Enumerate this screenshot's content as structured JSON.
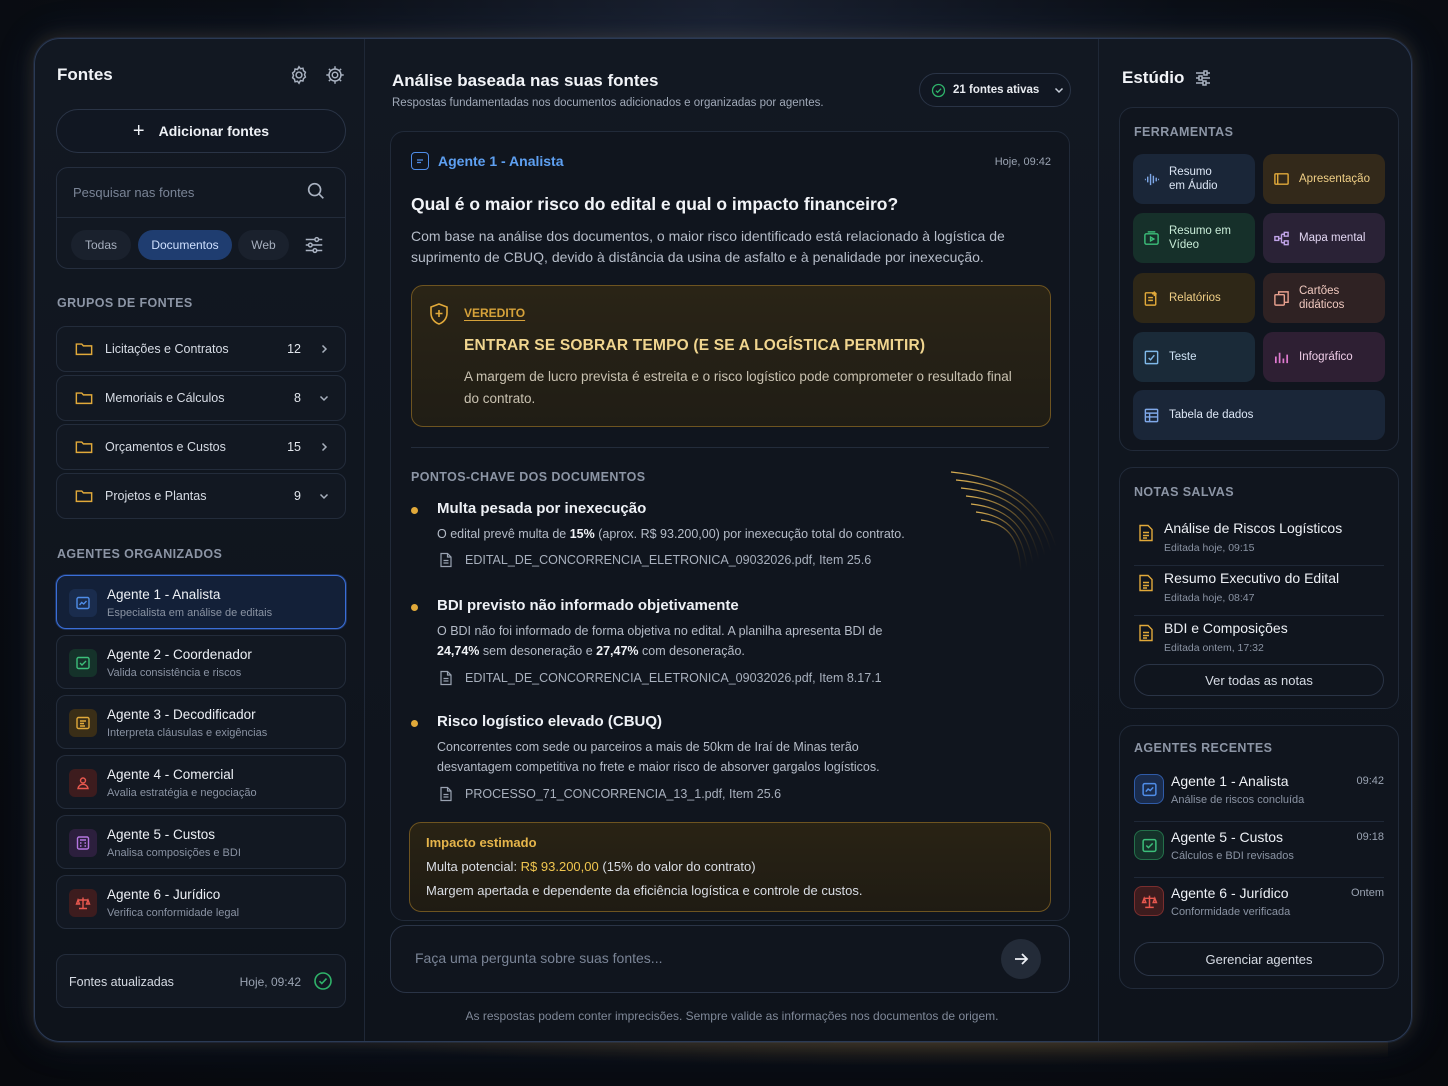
{
  "left": {
    "title": "Fontes",
    "add_sources": "Adicionar fontes",
    "search_placeholder": "Pesquisar nas fontes",
    "filters": [
      "Todas",
      "Documentos",
      "Web"
    ],
    "active_filter": "Documentos",
    "groups_label": "GRUPOS DE FONTES",
    "groups": [
      {
        "name": "Licitações e Contratos",
        "count": "12",
        "expanded": false
      },
      {
        "name": "Memoriais e Cálculos",
        "count": "8",
        "expanded": true
      },
      {
        "name": "Orçamentos e Custos",
        "count": "15",
        "expanded": false
      },
      {
        "name": "Projetos e Plantas",
        "count": "9",
        "expanded": true
      }
    ],
    "agents_label": "AGENTES ORGANIZADOS",
    "agents": [
      {
        "name": "Agente 1 - Analista",
        "desc": "Especialista em análise de editais",
        "color": "#4f8de8",
        "bg": "#1a2c4d",
        "icon": "chart-icon"
      },
      {
        "name": "Agente 2 - Coordenador",
        "desc": "Valida consistência e riscos",
        "color": "#3cbf7a",
        "bg": "#15322a",
        "icon": "check-square-icon"
      },
      {
        "name": "Agente 3 - Decodificador",
        "desc": "Interpreta cláusulas e exigências",
        "color": "#e1a93a",
        "bg": "#3a2e17",
        "icon": "document-scan-icon"
      },
      {
        "name": "Agente 4 - Comercial",
        "desc": "Avalia estratégia e negociação",
        "color": "#e8584f",
        "bg": "#3d1c1e",
        "icon": "person-icon"
      },
      {
        "name": "Agente 5 - Custos",
        "desc": "Analisa composições e BDI",
        "color": "#b476e0",
        "bg": "#2c1f3d",
        "icon": "calculator-icon"
      },
      {
        "name": "Agente 6 - Jurídico",
        "desc": "Verifica conformidade legal",
        "color": "#e8584f",
        "bg": "#3d1c1e",
        "icon": "scale-icon"
      }
    ],
    "active_agent": 0,
    "updated_label": "Fontes atualizadas",
    "updated_time": "Hoje, 09:42"
  },
  "main": {
    "title": "Análise baseada nas suas fontes",
    "subtitle": "Respostas fundamentadas nos documentos adicionados e organizadas por agentes.",
    "active_sources": "21 fontes ativas",
    "agent": "Agente 1 - Analista",
    "time": "Hoje, 09:42",
    "question": "Qual é o maior risco do edital e qual o impacto financeiro?",
    "answer": "Com base na análise dos documentos, o maior risco identificado está relacionado à logística de suprimento de CBUQ, devido à distância da usina de asfalto e à penalidade por inexecução.",
    "verdict": {
      "label": "VEREDITO",
      "headline": "ENTRAR SE SOBRAR TEMPO (E SE A LOGÍSTICA PERMITIR)",
      "text": "A margem de lucro prevista é estreita e o risco logístico pode comprometer o resultado final do contrato."
    },
    "key_points_label": "PONTOS-CHAVE DOS DOCUMENTOS",
    "key_points": [
      {
        "title": "Multa pesada por inexecução",
        "desc_html": "O edital prevê multa de <b>15%</b> (aprox. R$ 93.200,00) por inexecução total do contrato.",
        "source": "EDITAL_DE_CONCORRENCIA_ELETRONICA_09032026.pdf, Item 25.6"
      },
      {
        "title": "BDI previsto não informado objetivamente",
        "desc_html": "O BDI não foi informado de forma objetiva no edital. A planilha apresenta BDI de <b>24,74%</b> sem desoneração e <b>27,47%</b> com desoneração.",
        "source": "EDITAL_DE_CONCORRENCIA_ELETRONICA_09032026.pdf, Item 8.17.1"
      },
      {
        "title": "Risco logístico elevado (CBUQ)",
        "desc_html": "Concorrentes com sede ou parceiros a mais de 50km de Iraí de Minas terão desvantagem competitiva no frete e maior risco de absorver gargalos logísticos.",
        "source": "PROCESSO_71_CONCORRENCIA_13_1.pdf, Item 25.6"
      }
    ],
    "impact": {
      "label": "Impacto estimado",
      "line1_prefix": "Multa potencial: ",
      "line1_amount": "R$ 93.200,00",
      "line1_suffix": " (15% do valor do contrato)",
      "line2": "Margem apertada e dependente da eficiência logística e controle de custos."
    },
    "ask_placeholder": "Faça uma pergunta sobre suas fontes...",
    "disclaimer": "As respostas podem conter imprecisões. Sempre valide as informações nos documentos de origem."
  },
  "right": {
    "title": "Estúdio",
    "tools_label": "FERRAMENTAS",
    "tools": [
      {
        "label": "Resumo em Áudio",
        "color": "#7fa8e8",
        "bg": "#1a2638",
        "icon": "audio-wave-icon"
      },
      {
        "label": "Apresentação",
        "color": "#e1a93a",
        "bg": "#33291a",
        "icon": "presentation-icon"
      },
      {
        "label": "Resumo em Vídeo",
        "color": "#3cbf7a",
        "bg": "#16302a",
        "icon": "video-icon"
      },
      {
        "label": "Mapa mental",
        "color": "#c1a4e8",
        "bg": "#2a2236",
        "icon": "mind-map-icon"
      },
      {
        "label": "Relatórios",
        "color": "#e1a93a",
        "bg": "#2e2717",
        "icon": "report-icon"
      },
      {
        "label": "Cartões didáticos",
        "color": "#e8a08e",
        "bg": "#2f2223",
        "icon": "flashcards-icon"
      },
      {
        "label": "Teste",
        "color": "#7fb8e8",
        "bg": "#1a2a38",
        "icon": "quiz-icon"
      },
      {
        "label": "Infográfico",
        "color": "#e07ad0",
        "bg": "#2e1f33",
        "icon": "infographic-icon"
      },
      {
        "label": "Tabela de dados",
        "color": "#7fa8e8",
        "bg": "#1a2638",
        "icon": "table-icon"
      }
    ],
    "notes_label": "NOTAS SALVAS",
    "notes": [
      {
        "title": "Análise de Riscos Logísticos",
        "date": "Editada hoje, 09:15"
      },
      {
        "title": "Resumo Executivo do Edital",
        "date": "Editada hoje, 08:47"
      },
      {
        "title": "BDI e Composições",
        "date": "Editada ontem, 17:32"
      }
    ],
    "notes_button": "Ver todas as notas",
    "recent_label": "AGENTES RECENTES",
    "recent": [
      {
        "name": "Agente 1 - Analista",
        "desc": "Análise de riscos concluída",
        "time": "09:42",
        "color": "#4f8de8",
        "bg": "#1a2c4d"
      },
      {
        "name": "Agente 5 - Custos",
        "desc": "Cálculos e BDI revisados",
        "time": "09:18",
        "color": "#3cbf7a",
        "bg": "#15322a"
      },
      {
        "name": "Agente 6 - Jurídico",
        "desc": "Conformidade verificada",
        "time": "Ontem",
        "color": "#e8584f",
        "bg": "#3d1c1e"
      }
    ],
    "recent_button": "Gerenciar agentes"
  }
}
